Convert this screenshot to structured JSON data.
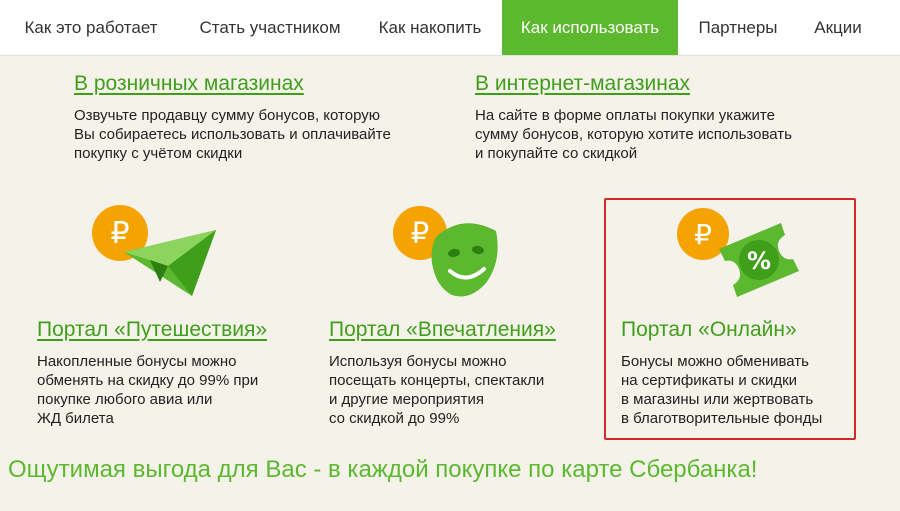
{
  "nav": {
    "items": [
      {
        "label": "Как это работает"
      },
      {
        "label": "Стать участником"
      },
      {
        "label": "Как накопить"
      },
      {
        "label": "Как использовать"
      },
      {
        "label": "Партнеры"
      },
      {
        "label": "Акции"
      }
    ]
  },
  "retail": {
    "title": "В розничных магазинах",
    "text": "Озвучьте продавцу сумму бонусов, которую\nВы собираетесь использовать и оплачивайте\nпокупку с учётом скидки"
  },
  "online_shops": {
    "title": "В интернет-магазинах",
    "text": "На сайте в форме оплаты покупки укажите\nсумму бонусов, которую хотите использовать\nи покупайте со скидкой"
  },
  "portals": [
    {
      "title": "Портал «Путешествия»",
      "text": "Накопленные бонусы можно\nобменять на скидку до 99% при\nпокупке любого авиа или\nЖД билета",
      "icon": "ruble-coin-paper-plane-icon"
    },
    {
      "title": "Портал «Впечатления»",
      "text": "Используя бонусы можно\nпосещать концерты, спектакли\nи другие мероприятия\nсо скидкой до 99%",
      "icon": "ruble-coin-smiling-mask-icon"
    },
    {
      "title": "Портал «Онлайн»",
      "text": "Бонусы можно обменивать\nна сертификаты и скидки\nв магазины или жертвовать\nв благотворительные фонды",
      "icon": "ruble-coin-percent-ticket-icon"
    }
  ],
  "coin_symbol": "₽",
  "percent_symbol": "%",
  "promo": "Ощутимая выгода для Вас - в каждой покупке по карте Сбербанка!",
  "colors": {
    "brand_green": "#5cb82f",
    "link_green": "#3f9e1a",
    "coin_orange": "#f5a300",
    "highlight_red": "#d12a2a",
    "background": "#f5f2ea"
  }
}
